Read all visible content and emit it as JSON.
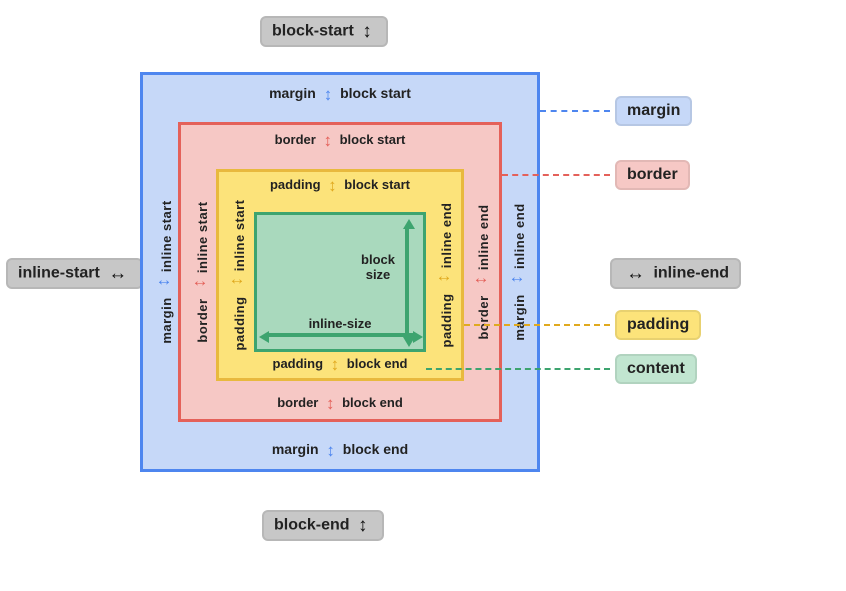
{
  "outer": {
    "block_start": "block-start",
    "block_end": "block-end",
    "inline_start": "inline-start",
    "inline_end": "inline-end"
  },
  "margin": {
    "top1": "margin",
    "top2": "block start",
    "bottom1": "margin",
    "bottom2": "block end",
    "left1": "margin",
    "left2": "inline start",
    "right1": "margin",
    "right2": "inline end"
  },
  "border": {
    "top1": "border",
    "top2": "block start",
    "bottom1": "border",
    "bottom2": "block end",
    "left1": "border",
    "left2": "inline start",
    "right1": "border",
    "right2": "inline end"
  },
  "padding": {
    "top1": "padding",
    "top2": "block start",
    "bottom1": "padding",
    "bottom2": "block end",
    "left1": "padding",
    "left2": "inline start",
    "right1": "padding",
    "right2": "inline end"
  },
  "content": {
    "block_size": "block\nsize",
    "inline_size": "inline-size"
  },
  "legend": {
    "margin": "margin",
    "border": "border",
    "padding": "padding",
    "content": "content"
  }
}
